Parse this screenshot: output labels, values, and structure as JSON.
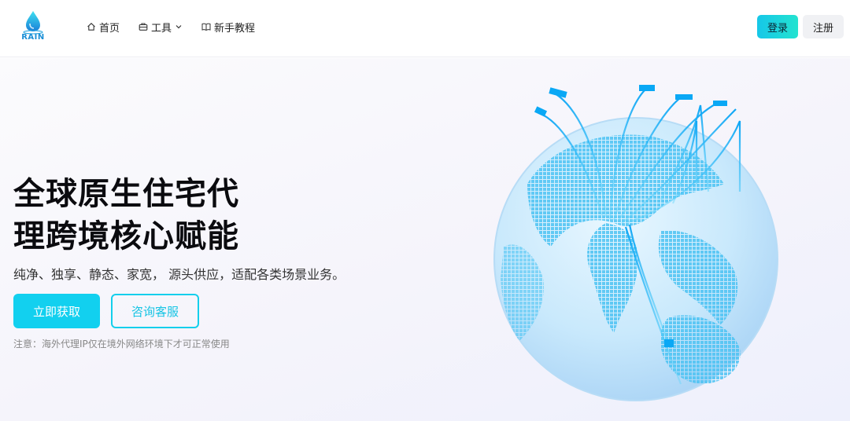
{
  "header": {
    "logo_text": "RAIN",
    "nav": [
      {
        "label": "首页",
        "icon": "home-icon"
      },
      {
        "label": "工具",
        "icon": "toolbox-icon",
        "has_dropdown": true
      },
      {
        "label": "新手教程",
        "icon": "book-icon"
      }
    ],
    "login_label": "登录",
    "register_label": "注册"
  },
  "hero": {
    "title_line1": "全球原生住宅代",
    "title_line2": "理跨境核心赋能",
    "subtitle": "纯净、独享、静态、家宽， 源头供应，适配各类场景业务。",
    "primary_button": "立即获取",
    "secondary_button": "咨询客服",
    "note": "注意：海外代理IP仅在境外网络环境下才可正常使用"
  },
  "colors": {
    "accent": "#12d0ef",
    "accent_gradient_end": "#23e3d0",
    "globe_blue": "#5fc8f5"
  }
}
